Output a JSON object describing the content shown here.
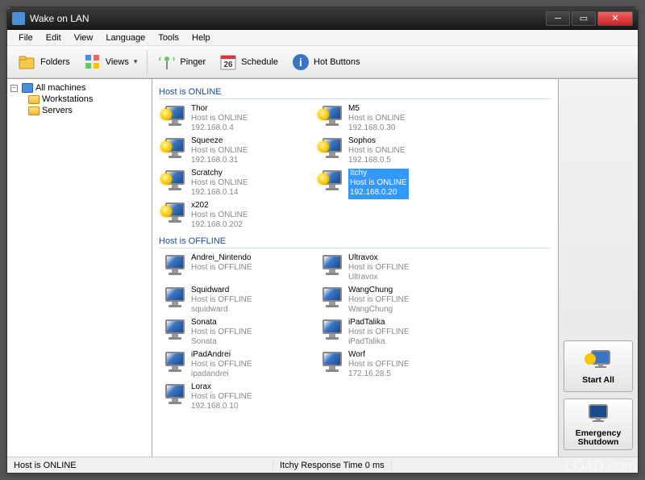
{
  "window": {
    "title": "Wake on LAN"
  },
  "menubar": [
    "File",
    "Edit",
    "View",
    "Language",
    "Tools",
    "Help"
  ],
  "toolbar": {
    "folders": "Folders",
    "views": "Views",
    "pinger": "Pinger",
    "schedule": "Schedule",
    "schedule_day": "26",
    "hotbuttons": "Hot Buttons"
  },
  "tree": {
    "root": "All machines",
    "children": [
      "Workstations",
      "Servers"
    ]
  },
  "groups": [
    {
      "title": "Host is ONLINE",
      "online": true,
      "hosts": [
        {
          "name": "Thor",
          "status": "Host is ONLINE",
          "ip": "192.168.0.4"
        },
        {
          "name": "M5",
          "status": "Host is ONLINE",
          "ip": "192.168.0.30"
        },
        {
          "name": "Squeeze",
          "status": "Host is ONLINE",
          "ip": "192.168.0.31"
        },
        {
          "name": "Sophos",
          "status": "Host is ONLINE",
          "ip": "192.168.0.5"
        },
        {
          "name": "Scratchy",
          "status": "Host is ONLINE",
          "ip": "192.168.0.14"
        },
        {
          "name": "Itchy",
          "status": "Host is ONLINE",
          "ip": "192.168.0.20",
          "selected": true
        },
        {
          "name": "x202",
          "status": "Host is ONLINE",
          "ip": "192.168.0.202"
        }
      ]
    },
    {
      "title": "Host is OFFLINE",
      "online": false,
      "hosts": [
        {
          "name": "Andrei_Nintendo",
          "status": "Host is OFFLINE",
          "ip": ""
        },
        {
          "name": "Ultravox",
          "status": "Host is OFFLINE",
          "ip": "Ultravox"
        },
        {
          "name": "Squidward",
          "status": "Host is OFFLINE",
          "ip": "squidward"
        },
        {
          "name": "WangChung",
          "status": "Host is OFFLINE",
          "ip": "WangChung"
        },
        {
          "name": "Sonata",
          "status": "Host is OFFLINE",
          "ip": "Sonata"
        },
        {
          "name": "iPadTalika",
          "status": "Host is OFFLINE",
          "ip": "iPadTalika"
        },
        {
          "name": "iPadAndrei",
          "status": "Host is OFFLINE",
          "ip": "ipadandrei"
        },
        {
          "name": "Worf",
          "status": "Host is OFFLINE",
          "ip": "172.16.28.5"
        },
        {
          "name": "Lorax",
          "status": "Host is OFFLINE",
          "ip": "192.168.0.10"
        }
      ]
    }
  ],
  "sidebuttons": {
    "start_all": "Start All",
    "emergency": "Emergency\nShutdown"
  },
  "statusbar": {
    "left": "Host is ONLINE",
    "right": "Itchy Response Time 0 ms"
  },
  "watermark": "LO4D.com"
}
